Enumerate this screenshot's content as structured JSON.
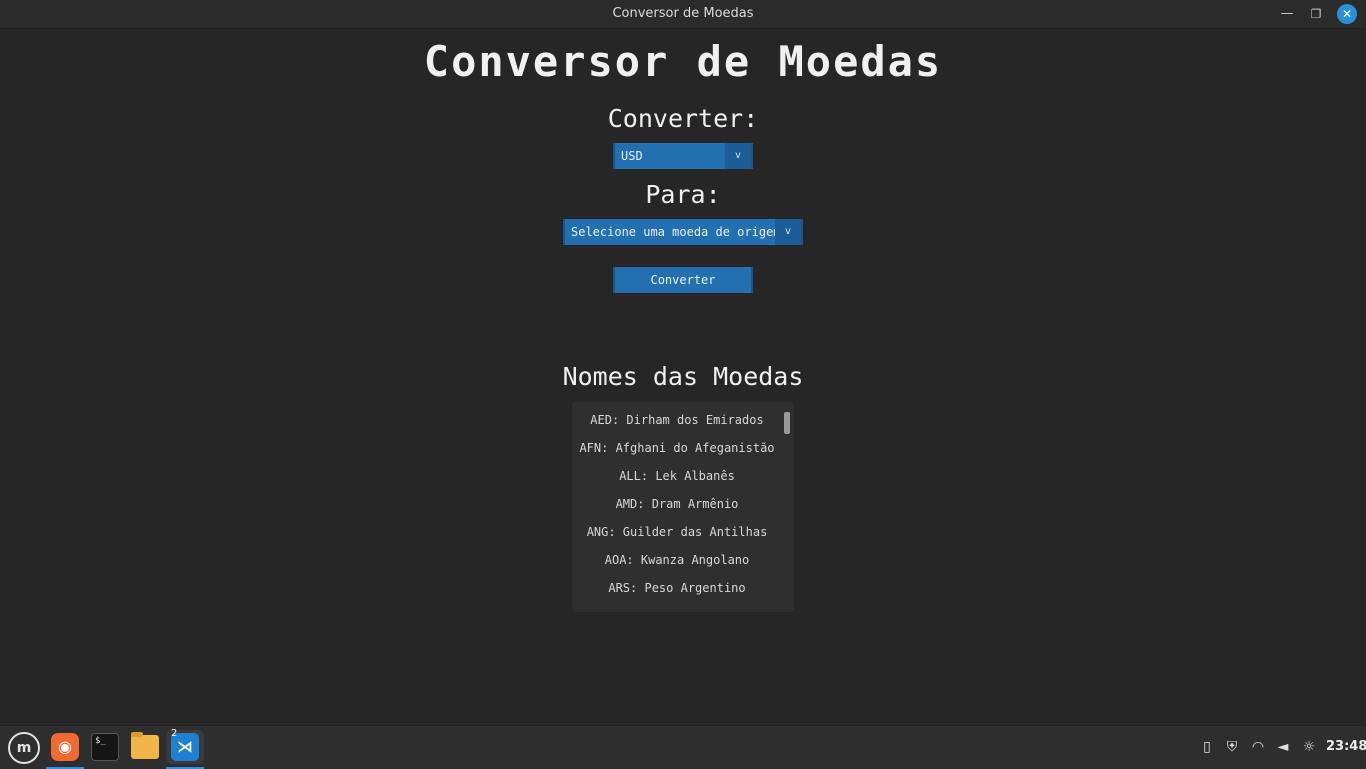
{
  "window": {
    "title": "Conversor de Moedas",
    "minimize_glyph": "—",
    "maximize_glyph": "❐",
    "close_glyph": "✕"
  },
  "app": {
    "heading": "Conversor de Moedas",
    "convert_from_label": "Converter:",
    "from_select": {
      "value": "USD",
      "arrow": "v"
    },
    "convert_to_label": "Para:",
    "to_select": {
      "value": "Selecione uma moeda de origem",
      "arrow": "v"
    },
    "convert_button": "Converter",
    "names_heading": "Nomes das Moedas",
    "currency_names": [
      "AED: Dirham dos Emirados",
      "AFN: Afghani do Afeganistão",
      "ALL: Lek Albanês",
      "AMD: Dram Armênio",
      "ANG: Guilder das Antilhas",
      "AOA: Kwanza Angolano",
      "ARS: Peso Argentino"
    ]
  },
  "taskbar": {
    "menu_icon": "menu-icon",
    "menu_glyph": "m",
    "firefox_glyph": "◉",
    "terminal_glyph": "$_",
    "vscode_glyph": "⋊",
    "vscode_badge": "2",
    "tray": [
      "clipboard-icon",
      "shield-icon",
      "wifi-icon",
      "volume-icon",
      "brightness-icon"
    ],
    "tray_glyphs": [
      "▯",
      "⛨",
      "◠",
      "◄",
      "☼"
    ],
    "clock": "23:48"
  },
  "colors": {
    "background": "#262626",
    "accent": "#2270b0",
    "close_button": "#2b8fd8"
  }
}
